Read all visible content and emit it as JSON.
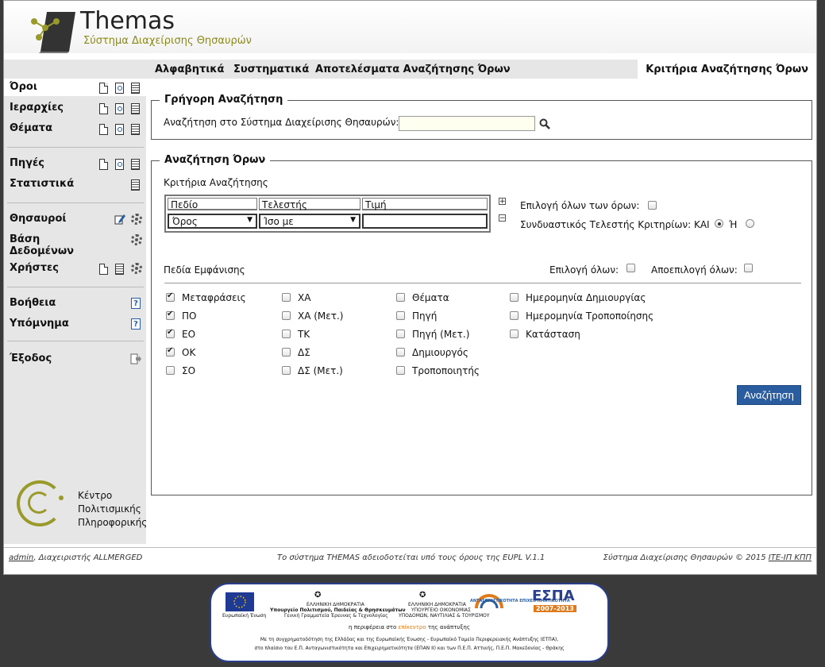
{
  "header": {
    "title": "Themas",
    "subtitle": "Σύστημα Διαχείρισης Θησαυρών"
  },
  "topnav": {
    "tabs": [
      "Αλφαβητικά",
      "Συστηματικά",
      "Αποτελέσματα Αναζήτησης Όρων"
    ],
    "active_tab": "Κριτήρια Αναζήτησης Όρων"
  },
  "sidebar": {
    "items": [
      {
        "label": "Όροι"
      },
      {
        "label": "Ιεραρχίες"
      },
      {
        "label": "Θέματα"
      },
      {
        "label": "Πηγές"
      },
      {
        "label": "Στατιστικά"
      },
      {
        "label": "Θησαυροί"
      },
      {
        "label": "Βάση Δεδομένων"
      },
      {
        "label": "Χρήστες"
      },
      {
        "label": "Βοήθεια"
      },
      {
        "label": "Υπόμνημα"
      },
      {
        "label": "Έξοδος"
      }
    ],
    "logo_text": "Κέντρο Πολιτισμικής Πληροφορικής"
  },
  "quick_search": {
    "legend": "Γρήγορη Αναζήτηση",
    "label": "Αναζήτηση στο Σύστημα Διαχείρισης Θησαυρών:",
    "value": ""
  },
  "term_search": {
    "legend": "Αναζήτηση Όρων",
    "criteria_label": "Κριτήρια Αναζήτησης",
    "columns": [
      "Πεδίο",
      "Τελεστής",
      "Τιμή"
    ],
    "field_value": "Όρος",
    "operator_value": "Ίσο με",
    "value": "",
    "select_all_terms_label": "Επιλογή όλων των όρων:",
    "combine_label": "Συνδυαστικός Τελεστής Κριτηρίων: ΚΑΙ",
    "or_label": "Ή",
    "display_fields_label": "Πεδία Εμφάνισης",
    "select_all_label": "Επιλογή όλων:",
    "deselect_all_label": "Αποεπιλογή όλων:",
    "fields": [
      {
        "label": "Μεταφράσεις",
        "checked": true
      },
      {
        "label": "ΠΟ",
        "checked": true
      },
      {
        "label": "ΕΟ",
        "checked": true
      },
      {
        "label": "ΟΚ",
        "checked": true
      },
      {
        "label": "ΣΟ",
        "checked": false
      },
      {
        "label": "ΧΑ",
        "checked": false
      },
      {
        "label": "ΧΑ (Μετ.)",
        "checked": false
      },
      {
        "label": "ΤΚ",
        "checked": false
      },
      {
        "label": "ΔΣ",
        "checked": false
      },
      {
        "label": "ΔΣ (Μετ.)",
        "checked": false
      },
      {
        "label": "Θέματα",
        "checked": false
      },
      {
        "label": "Πηγή",
        "checked": false
      },
      {
        "label": "Πηγή (Μετ.)",
        "checked": false
      },
      {
        "label": "Δημιουργός",
        "checked": false
      },
      {
        "label": "Τροποποιητής",
        "checked": false
      },
      {
        "label": "Ημερομηνία Δημιουργίας",
        "checked": false
      },
      {
        "label": "Ημερομηνία Τροποποίησης",
        "checked": false
      },
      {
        "label": "Κατάσταση",
        "checked": false
      }
    ],
    "search_button": "Αναζήτηση"
  },
  "footer": {
    "user_link": "admin",
    "user_role": ", Διαχειριστής ALLMERGED",
    "license": "Το σύστημα THEMAS αδειοδοτείται υπό τους όρους της EUPL V.1.1",
    "copyright": "Σύστημα Διαχείρισης Θησαυρών © 2015 ",
    "copyright_link": "ΙΤΕ-ΙΠ ΚΠΠ"
  },
  "espa": {
    "eu_label": "Ευρωπαϊκή Ένωση",
    "ministry1_line1": "ΕΛΛΗΝΙΚΗ ΔΗΜΟΚΡΑΤΙΑ",
    "ministry1_line2": "Υπουργείο Πολιτισμού, Παιδείας & Θρησκευμάτων",
    "ministry1_line3": "Γενική Γραμματεία Έρευνας & Τεχνολογίας",
    "ministry2_line1": "ΕΛΛΗΝΙΚΗ ΔΗΜΟΚΡΑΤΙΑ",
    "ministry2_line2": "ΥΠΟΥΡΓΕΙΟ ΟΙΚΟΝΟΜΙΑΣ",
    "ministry2_line3": "ΥΠΟΔΟΜΩΝ, ΝΑΥΤΙΛΙΑΣ & ΤΟΥΡΙΣΜΟΥ",
    "epan_label": "ΑΝΤΑΓΩΝΙΣΤΙΚΟΤΗΤΑ ΕΠΙΧΕΙΡΗΜΑΤΙΚΟΤΗΤΑ",
    "espa_label": "ΕΣΠΑ",
    "espa_years": "2007-2013",
    "tagline_pre": "η περιφέρεια στο ",
    "tagline_em": "επίκεντρο",
    "tagline_post": " της ανάπτυξης",
    "funding_line1": "Με τη συγχρηματοδότηση της Ελλάδας και της Ευρωπαϊκής Ένωσης - Ευρωπαϊκό Ταμείο Περιφερειακής Ανάπτυξης (ΕΤΠΑ),",
    "funding_line2": "στο πλαίσιο του Ε.Π. Ανταγωνιστικότητα και Επιχειρηματικότητα (ΕΠΑΝ ΙΙ) και των Π.Ε.Π. Αττικής, Π.Ε.Π. Μακεδονίας - Θράκης"
  },
  "colors": {
    "accent": "#2a5d9f",
    "nav_bg": "#e6e6e6",
    "logo_olive": "#8a8a1a"
  }
}
